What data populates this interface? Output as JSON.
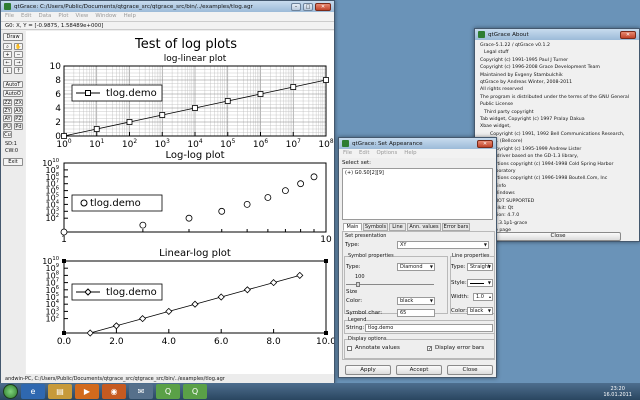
{
  "desktop": {
    "background": "#6a93b8"
  },
  "main_window": {
    "title": "qtGrace: C:/Users/Public/Documents/qtgrace_src/qtgrace_src/bin/../examples/tlog.agr",
    "menu": [
      "File",
      "Edit",
      "Data",
      "Plot",
      "View",
      "Window",
      "Help"
    ],
    "locator": "G0: X, Y = [-0.9875, 1.58489e+000]",
    "toolbar": {
      "draw": "Draw",
      "autot": "AutoT",
      "autoo": "AutoO",
      "zz": "ZZ",
      "zx": "ZX",
      "zy": "ZY",
      "ax": "AX",
      "ay": "AY",
      "pz": "PZ",
      "pu": "PU",
      "pd": "Pd",
      "cu": "Cu",
      "sd": "SD:1",
      "cw": "CW:0",
      "exit": "Exit"
    },
    "status": "andwin-PC, C:/Users/Public/Documents/qtgrace_src/qtgrace_src/bin/../examples/tlog.agr"
  },
  "plot": {
    "title": "Test of log plots",
    "graphs": [
      {
        "subtitle": "log-linear plot",
        "legend": "tlog.demo",
        "x_ticks": [
          "10",
          "10",
          "10",
          "10",
          "10",
          "10",
          "10",
          "10",
          "10"
        ],
        "x_exponents": [
          "0",
          "1",
          "2",
          "3",
          "4",
          "5",
          "6",
          "7",
          "8"
        ],
        "y_ticks": [
          "10",
          "8",
          "6",
          "4",
          "2",
          "0"
        ]
      },
      {
        "subtitle": "Log-log plot",
        "legend": "tlog.demo",
        "x_ticks": [
          "1",
          "10"
        ],
        "y_ticks": [
          "10",
          "10",
          "10",
          "10",
          "10",
          "10",
          "10",
          "10",
          "10"
        ],
        "y_exponents": [
          "10",
          "9",
          "8",
          "7",
          "6",
          "5",
          "4",
          "3",
          "2"
        ]
      },
      {
        "subtitle": "Linear-log plot",
        "legend": "tlog.demo",
        "x_ticks": [
          "0.0",
          "2.0",
          "4.0",
          "6.0",
          "8.0",
          "10.0"
        ],
        "y_ticks": [
          "10",
          "10",
          "10",
          "10",
          "10",
          "10",
          "10",
          "10",
          "10"
        ],
        "y_exponents": [
          "10",
          "9",
          "8",
          "7",
          "6",
          "5",
          "4",
          "3",
          "2"
        ]
      }
    ]
  },
  "chart_data": [
    {
      "type": "line",
      "title": "log-linear plot",
      "series": [
        {
          "name": "tlog.demo",
          "x": [
            1,
            10,
            100,
            1000,
            10000,
            100000,
            1000000,
            10000000,
            100000000
          ],
          "y": [
            0,
            1,
            2,
            3,
            4,
            5,
            6,
            7,
            8
          ]
        }
      ],
      "xlim": [
        1,
        100000000
      ],
      "ylim": [
        0,
        10
      ],
      "xscale": "log",
      "grid": true,
      "legend": "left"
    },
    {
      "type": "scatter",
      "title": "Log-log plot",
      "series": [
        {
          "name": "tlog.demo",
          "x": [
            1,
            2,
            3,
            4,
            5,
            6,
            7,
            8,
            9
          ],
          "y": [
            1,
            10,
            100,
            1000,
            10000,
            100000,
            1000000,
            10000000,
            100000000
          ]
        }
      ],
      "xlim": [
        1,
        10
      ],
      "ylim": [
        1,
        10000000000
      ],
      "xscale": "log",
      "yscale": "log",
      "grid": false,
      "legend": "left"
    },
    {
      "type": "line",
      "title": "Linear-log plot",
      "series": [
        {
          "name": "tlog.demo",
          "x": [
            1,
            2,
            3,
            4,
            5,
            6,
            7,
            8,
            9
          ],
          "y": [
            1,
            10,
            100,
            1000,
            10000,
            100000,
            1000000,
            10000000,
            100000000
          ]
        }
      ],
      "xlim": [
        0,
        10
      ],
      "ylim": [
        1,
        10000000000
      ],
      "yscale": "log",
      "grid": false,
      "legend": "left"
    }
  ],
  "appearance": {
    "title": "qtGrace: Set Appearance",
    "menu": [
      "File",
      "Edit",
      "Options",
      "Help"
    ],
    "select_set": "Select set:",
    "set_item": "(+) G0.S0[2][9]",
    "tabs": [
      "Main",
      "Symbols",
      "Line",
      "Ann. values",
      "Error bars"
    ],
    "set_presentation": "Set presentation",
    "type_label": "Type:",
    "type_value": "XY",
    "symbol_properties": "Symbol properties",
    "symbol_type_label": "Type:",
    "symbol_type_value": "Diamond",
    "size_label": "Size",
    "size_value": "100",
    "color_label": "Color:",
    "color_value": "black",
    "symbol_char_label": "Symbol char:",
    "symbol_char_value": "65",
    "line_properties": "Line properties",
    "line_type_label": "Type:",
    "line_type_value": "Straight",
    "style_label": "Style:",
    "width_label": "Width:",
    "width_value": "1.0",
    "line_color_label": "Color:",
    "line_color_value": "black",
    "legend_group": "Legend",
    "string_label": "String:",
    "string_value": "tlog.demo",
    "display_options": "Display options",
    "annotate_values": "Annotate values",
    "annotate_checked": false,
    "display_error_bars": "Display error bars",
    "error_checked": true,
    "buttons": {
      "apply": "Apply",
      "accept": "Accept",
      "close": "Close"
    }
  },
  "about": {
    "title": "qtGrace About",
    "lines": [
      "Grace-5.1.22 / qtGrace v0.1.2",
      "Legal stuff",
      "Copyright (c) 1991-1995 Paul J Turner",
      "Copyright (c) 1996-2008 Grace Development Team",
      "Maintained by Evgeny Stambulchik",
      "qtGrace by Andreas Winter, 2008-2011",
      "All rights reserved",
      "The program is distributed under the terms of the GNU General Public License",
      "Third party copyright",
      "Tab widget, Copyright (c) 1997 Pralay Dakua",
      "Xbae widget,",
      "Copyright (c) 1991, 1992 Bell Communications Research, Inc. (Bellcore)",
      "Copyright (c) 1995-1999 Andrew Lister",
      "Raster driver based on the GD-1.3 library,",
      "Portions copyright (c) 1994-1998 Cold Spring Harbor Laboratory",
      "Portions copyright (c) 1996-1998 Boutell.Com, Inc",
      "Build info",
      "Host: Windows",
      "Time: NOT SUPPORTED",
      "GUI toolkit: Qt",
      "Qt version: 4.7.0",
      "T1lib: 1.3.1p1-grace",
      "Home page",
      "http://plasma-gate.weizmann.ac.il/Grace/"
    ],
    "close": "Close"
  },
  "taskbar": {
    "time": "23:20",
    "date": "16.01.2011",
    "start_color": "#3c8c3a"
  }
}
